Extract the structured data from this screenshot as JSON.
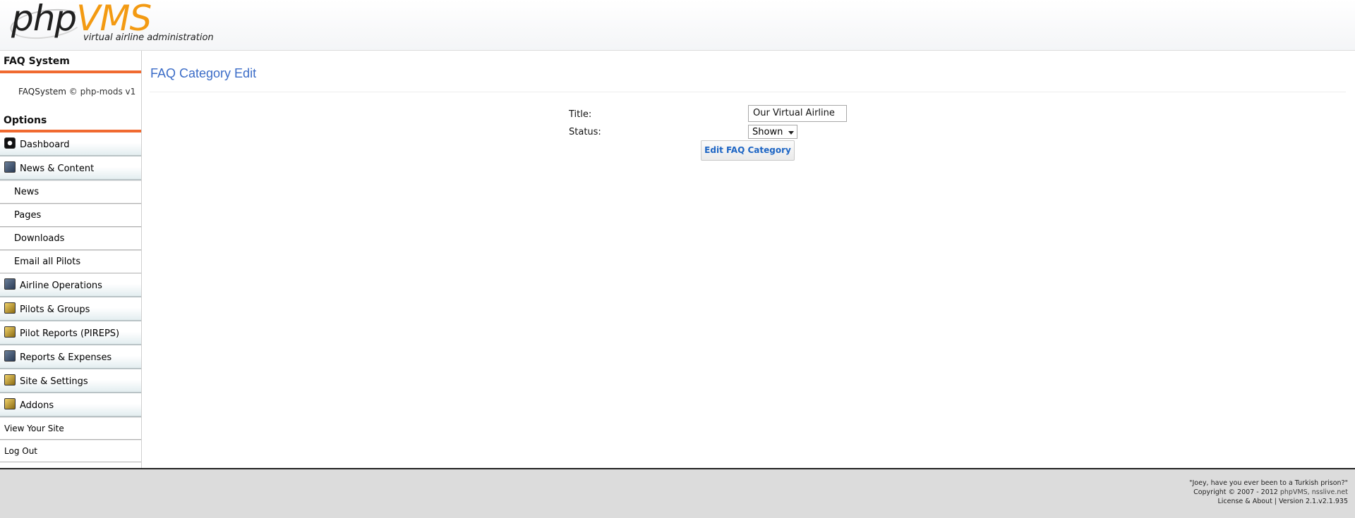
{
  "header": {
    "logo_php": "php",
    "logo_vms": "VMS",
    "logo_tagline": "virtual airline administration"
  },
  "sidebar": {
    "module_heading": "FAQ System",
    "module_credit_prefix": "FAQSystem ©",
    "module_credit_name": "php-mods v1",
    "options_heading": "Options",
    "items": [
      {
        "label": "Dashboard",
        "icon": "dashboard-icon"
      },
      {
        "label": "News & Content",
        "icon": "news-content-icon"
      },
      {
        "label": "Airline Operations",
        "icon": "airline-operations-icon"
      },
      {
        "label": "Pilots & Groups",
        "icon": "pilots-groups-icon"
      },
      {
        "label": "Pilot Reports (PIREPS)",
        "icon": "pilot-reports-icon"
      },
      {
        "label": "Reports & Expenses",
        "icon": "reports-expenses-icon"
      },
      {
        "label": "Site & Settings",
        "icon": "site-settings-icon"
      },
      {
        "label": "Addons",
        "icon": "addons-icon"
      }
    ],
    "sub_items": [
      "News",
      "Pages",
      "Downloads",
      "Email all Pilots"
    ],
    "view_site": "View Your Site",
    "log_out": "Log Out"
  },
  "main": {
    "page_title": "FAQ Category Edit",
    "form": {
      "title_label": "Title:",
      "title_value": "Our Virtual Airline",
      "status_label": "Status:",
      "status_value": "Shown",
      "submit_label": "Edit FAQ Category"
    }
  },
  "footer": {
    "quote": "\"Joey, have you ever been to a Turkish prison?\"",
    "copyright_prefix": "Copyright © 2007 - 2012",
    "copyright_links": "phpVMS, nsslive.net",
    "license": "License & About | Version 2.1.v2.1.935"
  },
  "colors": {
    "accent_orange": "#f06a30",
    "logo_orange": "#f39a12",
    "title_blue": "#3b6cc7",
    "button_text_blue": "#1d65c4",
    "footer_bg": "#dcdcdc"
  }
}
